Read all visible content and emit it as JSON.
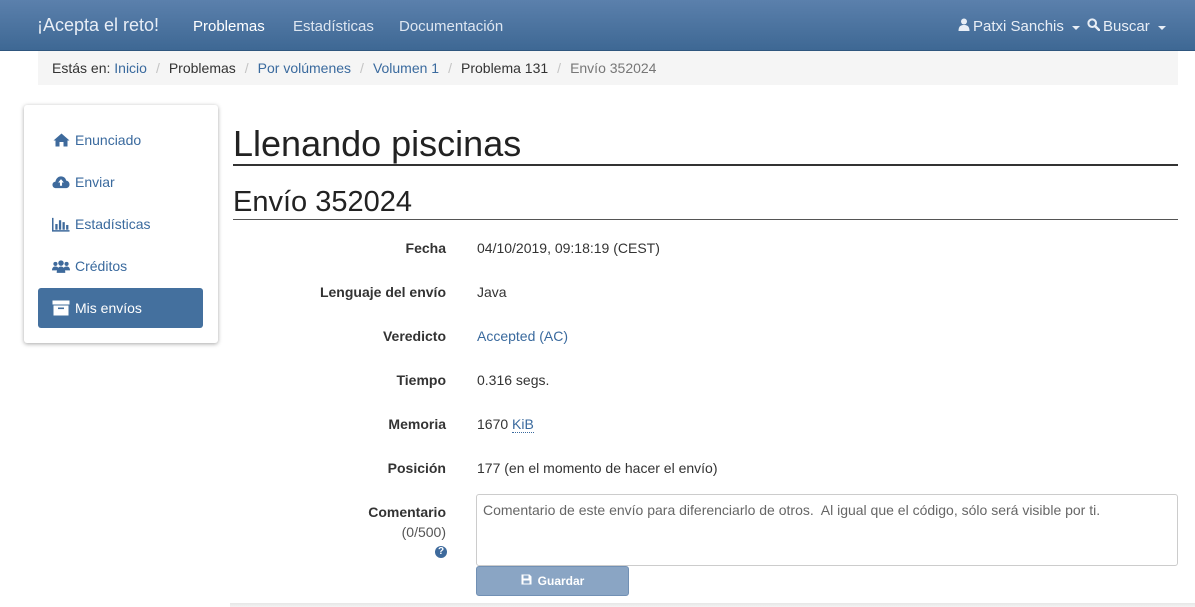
{
  "navbar": {
    "brand": "¡Acepta el reto!",
    "links": [
      "Problemas",
      "Estadísticas",
      "Documentación"
    ],
    "user": "Patxi Sanchis",
    "search": "Buscar"
  },
  "breadcrumb": {
    "prefix": "Estás en:",
    "items": [
      "Inicio",
      "Problemas",
      "Por volúmenes",
      "Volumen 1",
      "Problema 131",
      "Envío 352024"
    ]
  },
  "sidebar": {
    "items": [
      {
        "label": "Enunciado",
        "icon": "home-icon"
      },
      {
        "label": "Enviar",
        "icon": "cloud-upload-icon"
      },
      {
        "label": "Estadísticas",
        "icon": "bar-chart-icon"
      },
      {
        "label": "Créditos",
        "icon": "users-icon"
      },
      {
        "label": "Mis envíos",
        "icon": "archive-icon"
      }
    ]
  },
  "main": {
    "title": "Llenando piscinas",
    "subtitle": "Envío 352024",
    "rows": {
      "fecha": {
        "label": "Fecha",
        "value": "04/10/2019, 09:18:19 (CEST)"
      },
      "lenguaje": {
        "label": "Lenguaje del envío",
        "value": "Java"
      },
      "veredicto": {
        "label": "Veredicto",
        "value": "Accepted (AC)"
      },
      "tiempo": {
        "label": "Tiempo",
        "value": "0.316 segs."
      },
      "memoria": {
        "label": "Memoria",
        "value": "1670",
        "unit": "KiB"
      },
      "posicion": {
        "label": "Posición",
        "value": "177 (en el momento de hacer el envío)"
      }
    },
    "comment": {
      "label": "Comentario",
      "count": "(0/500)",
      "placeholder": "Comentario de este envío para diferenciarlo de otros.  Al igual que el código, sólo será visible por ti.",
      "save_label": "Guardar"
    }
  },
  "colors": {
    "navbar": "#4a729f",
    "accent": "#3a6a9e",
    "active_sidebar": "#44709e",
    "save_button": "#8aa5c4"
  }
}
